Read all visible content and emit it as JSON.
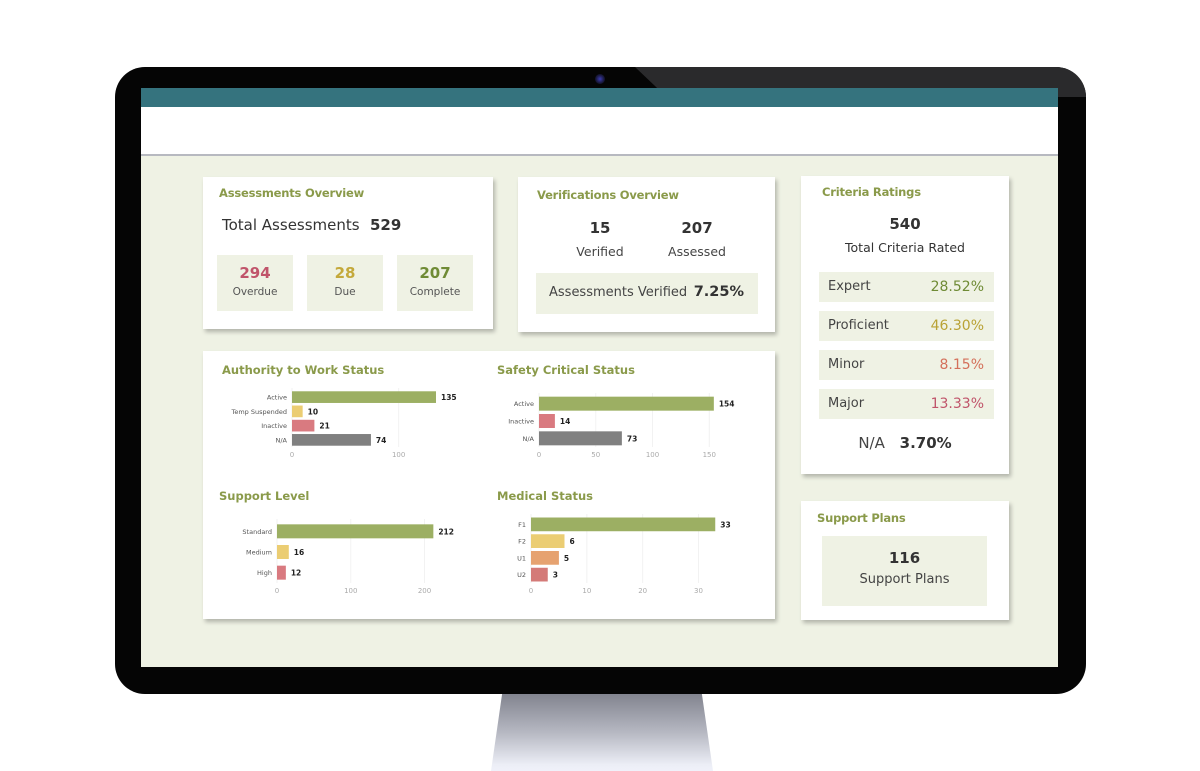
{
  "colors": {
    "accent_title": "#8a9a4a",
    "topbar": "#35737e",
    "screen_bg": "#eff2e4",
    "red": "#c0546a",
    "yellow": "#c4a93b",
    "green": "#6f8b35",
    "orange": "#d4805a",
    "bar_green": "#9caf63",
    "bar_yellow": "#ebcd73",
    "bar_red": "#d97a80",
    "bar_gray": "#808080",
    "bar_orange": "#e6a270",
    "bar_rose": "#d47a78"
  },
  "assessments": {
    "title": "Assessments Overview",
    "total_label": "Total Assessments",
    "total_value": "529",
    "tiles": [
      {
        "value": "294",
        "label": "Overdue",
        "color": "#c0546a"
      },
      {
        "value": "28",
        "label": "Due",
        "color": "#c4a93b"
      },
      {
        "value": "207",
        "label": "Complete",
        "color": "#6f8b35"
      }
    ]
  },
  "verifications": {
    "title": "Verifications Overview",
    "verified_value": "15",
    "verified_label": "Verified",
    "assessed_value": "207",
    "assessed_label": "Assessed",
    "percent_label": "Assessments Verified",
    "percent_value": "7.25%"
  },
  "criteria": {
    "title": "Criteria Ratings",
    "total_value": "540",
    "total_label": "Total Criteria Rated",
    "rows": [
      {
        "label": "Expert",
        "value": "28.52%",
        "color": "#6f8b35"
      },
      {
        "label": "Proficient",
        "value": "46.30%",
        "color": "#b9a235"
      },
      {
        "label": "Minor",
        "value": "8.15%",
        "color": "#d4705a"
      },
      {
        "label": "Major",
        "value": "13.33%",
        "color": "#c0546a"
      }
    ],
    "na_label": "N/A",
    "na_value": "3.70%"
  },
  "support_plans": {
    "title": "Support Plans",
    "value": "116",
    "label": "Support Plans"
  },
  "chart_data": [
    {
      "type": "bar",
      "orientation": "horizontal",
      "title": "Authority to Work Status",
      "categories": [
        "Active",
        "Temp Suspended",
        "Inactive",
        "N/A"
      ],
      "values": [
        135,
        10,
        21,
        74
      ],
      "colors": [
        "#9caf63",
        "#ebcd73",
        "#d97a80",
        "#808080"
      ],
      "xlim": [
        0,
        150
      ],
      "ticks": [
        0,
        100
      ],
      "grid": true,
      "legend": "none"
    },
    {
      "type": "bar",
      "orientation": "horizontal",
      "title": "Safety Critical Status",
      "categories": [
        "Active",
        "Inactive",
        "N/A"
      ],
      "values": [
        154,
        14,
        73
      ],
      "colors": [
        "#9caf63",
        "#d97a80",
        "#808080"
      ],
      "xlim": [
        0,
        170
      ],
      "ticks": [
        0,
        50,
        100,
        150
      ],
      "grid": true,
      "legend": "none"
    },
    {
      "type": "bar",
      "orientation": "horizontal",
      "title": "Support Level",
      "categories": [
        "Standard",
        "Medium",
        "High"
      ],
      "values": [
        212,
        16,
        12
      ],
      "colors": [
        "#9caf63",
        "#ebcd73",
        "#d97a80"
      ],
      "xlim": [
        0,
        240
      ],
      "ticks": [
        0,
        100,
        200
      ],
      "grid": true,
      "legend": "none"
    },
    {
      "type": "bar",
      "orientation": "horizontal",
      "title": "Medical Status",
      "categories": [
        "F1",
        "F2",
        "U1",
        "U2"
      ],
      "values": [
        33,
        6,
        5,
        3
      ],
      "colors": [
        "#9caf63",
        "#ebcd73",
        "#e6a270",
        "#d47a78"
      ],
      "xlim": [
        0,
        36
      ],
      "ticks": [
        0,
        10,
        20,
        30
      ],
      "grid": true,
      "legend": "none"
    }
  ]
}
